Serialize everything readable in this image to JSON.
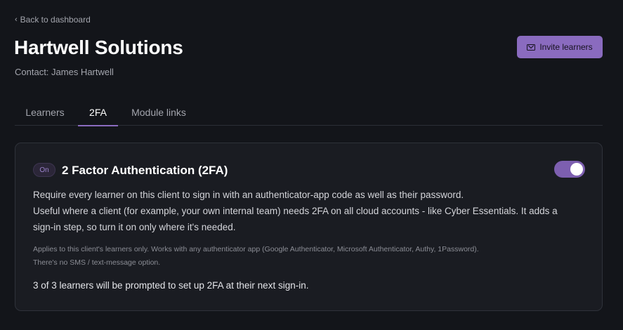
{
  "nav": {
    "back_label": "Back to dashboard",
    "back_glyph": "‹"
  },
  "header": {
    "title": "Hartwell Solutions",
    "contact": "Contact: James Hartwell",
    "invite_label": "Invite learners",
    "invite_icon": "mail-icon"
  },
  "tabs": [
    {
      "label": "Learners",
      "active": false
    },
    {
      "label": "2FA",
      "active": true
    },
    {
      "label": "Module links",
      "active": false
    }
  ],
  "twofa": {
    "status_badge": "On",
    "title": "2 Factor Authentication (2FA)",
    "enabled": true,
    "description": [
      "Require every learner on this client to sign in with an authenticator-app code as well as their password.",
      "Useful where a client (for example, your own internal team) needs 2FA on all cloud accounts - like Cyber Essentials. It adds a sign-in step, so turn it on only where it's needed."
    ],
    "note": [
      "Applies to this client's learners only. Works with any authenticator app (Google Authenticator, Microsoft Authenticator, Authy, 1Password).",
      "There's no SMS / text-message option."
    ],
    "prompt_count": "3 of 3 learners will be prompted to set up 2FA at their next sign-in."
  },
  "colors": {
    "background": "#13151a",
    "card": "#1a1c22",
    "accent": "#8a6bbf",
    "toggle_on": "#7d5fb0"
  }
}
